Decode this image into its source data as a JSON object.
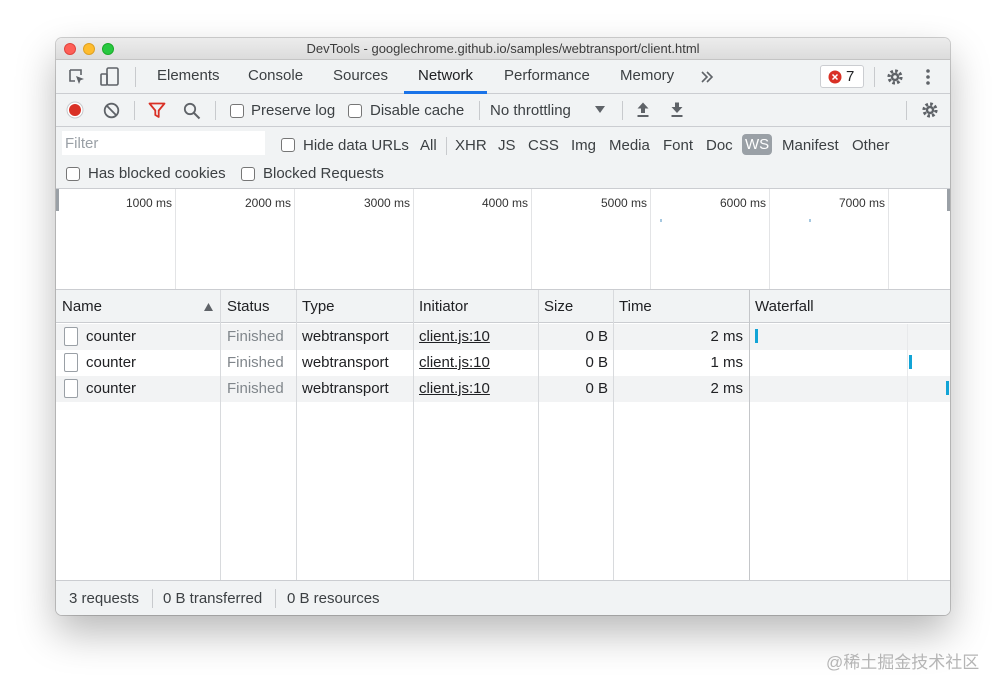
{
  "window": {
    "title": "DevTools - googlechrome.github.io/samples/webtransport/client.html"
  },
  "tabs": [
    {
      "label": "Elements"
    },
    {
      "label": "Console"
    },
    {
      "label": "Sources"
    },
    {
      "label": "Network",
      "active": true
    },
    {
      "label": "Performance"
    },
    {
      "label": "Memory"
    }
  ],
  "badge": {
    "errors": "7"
  },
  "toolbar": {
    "preserve_log": "Preserve log",
    "disable_cache": "Disable cache",
    "throttling": "No throttling"
  },
  "filter": {
    "placeholder": "Filter",
    "hide_data_urls": "Hide data URLs",
    "types": [
      "All",
      "XHR",
      "JS",
      "CSS",
      "Img",
      "Media",
      "Font",
      "Doc",
      "WS",
      "Manifest",
      "Other"
    ],
    "active_type": "WS",
    "has_blocked_cookies": "Has blocked cookies",
    "blocked_requests": "Blocked Requests"
  },
  "overview": {
    "ticks": [
      "1000 ms",
      "2000 ms",
      "3000 ms",
      "4000 ms",
      "5000 ms",
      "6000 ms",
      "7000 ms"
    ]
  },
  "table": {
    "headers": [
      "Name",
      "Status",
      "Type",
      "Initiator",
      "Size",
      "Time",
      "Waterfall"
    ],
    "rows": [
      {
        "name": "counter",
        "status": "Finished",
        "type": "webtransport",
        "initiator": "client.js:10",
        "size": "0 B",
        "time": "2 ms"
      },
      {
        "name": "counter",
        "status": "Finished",
        "type": "webtransport",
        "initiator": "client.js:10",
        "size": "0 B",
        "time": "1 ms"
      },
      {
        "name": "counter",
        "status": "Finished",
        "type": "webtransport",
        "initiator": "client.js:10",
        "size": "0 B",
        "time": "2 ms"
      }
    ]
  },
  "statusbar": {
    "requests": "3 requests",
    "transferred": "0 B transferred",
    "resources": "0 B resources"
  },
  "watermark": "@稀土掘金技术社区",
  "colors": {
    "accent": "#1a73e8",
    "record": "#d93025",
    "filter_icon": "#d93025",
    "waterfall_bar": "#12a4d6",
    "ws_chip": "#9aa0a6"
  }
}
